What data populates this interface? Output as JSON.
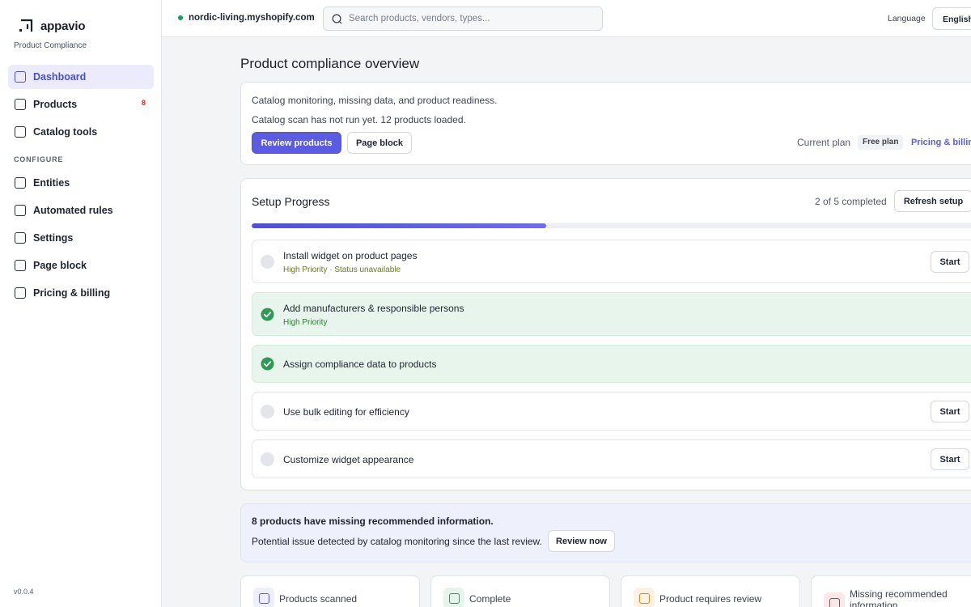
{
  "app": {
    "brand_name": "appavio",
    "subtitle": "Product Compliance",
    "version": "v0.0.4"
  },
  "sidebar": {
    "items": [
      {
        "label": "Dashboard",
        "active": true
      },
      {
        "label": "Products",
        "badge": "8"
      },
      {
        "label": "Catalog tools"
      }
    ],
    "section_label": "CONFIGURE",
    "config_items": [
      {
        "label": "Entities"
      },
      {
        "label": "Automated rules"
      },
      {
        "label": "Settings"
      },
      {
        "label": "Page block"
      },
      {
        "label": "Pricing & billing"
      }
    ]
  },
  "topbar": {
    "store": "nordic-living.myshopify.com",
    "search_placeholder": "Search products, vendors, types...",
    "language_label": "Language",
    "language_value": "English"
  },
  "main": {
    "title": "Product compliance overview",
    "intro": {
      "line1": "Catalog monitoring, missing data, and product readiness.",
      "line2": "Catalog scan has not run yet. 12 products loaded.",
      "review_button": "Review products",
      "page_block_button": "Page block",
      "plan_label": "Current plan",
      "plan_value": "Free plan",
      "plan_link": "Pricing & billing"
    },
    "setup": {
      "title": "Setup Progress",
      "count": "2 of 5 completed",
      "refresh_button": "Refresh setup",
      "progress": 0.4,
      "tasks": [
        {
          "title": "Install widget on product pages",
          "sub": "High Priority · Status unavailable",
          "done": false,
          "action": "Start"
        },
        {
          "title": "Add manufacturers & responsible persons",
          "sub": "High Priority",
          "done": true
        },
        {
          "title": "Assign compliance data to products",
          "done": true
        },
        {
          "title": "Use bulk editing for efficiency",
          "done": false,
          "action": "Start"
        },
        {
          "title": "Customize widget appearance",
          "done": false,
          "action": "Start"
        }
      ]
    },
    "alert": {
      "title": "8 products have missing recommended information.",
      "text": "Potential issue detected by catalog monitoring since the last review.",
      "button": "Review now"
    },
    "stats": [
      {
        "label": "Products scanned",
        "color": "#5b5ce2",
        "bg": "#eeeefc"
      },
      {
        "label": "Complete",
        "color": "#2e9a55",
        "bg": "#e6f5ec"
      },
      {
        "label": "Product requires review",
        "color": "#d98a1a",
        "bg": "#fdf2e2"
      },
      {
        "label": "Missing recommended information",
        "color": "#d0352d",
        "bg": "#fde8e7"
      }
    ]
  },
  "colors": {
    "accent": "#5b5ce2",
    "success": "#2e9a55",
    "danger": "#d0352d"
  }
}
